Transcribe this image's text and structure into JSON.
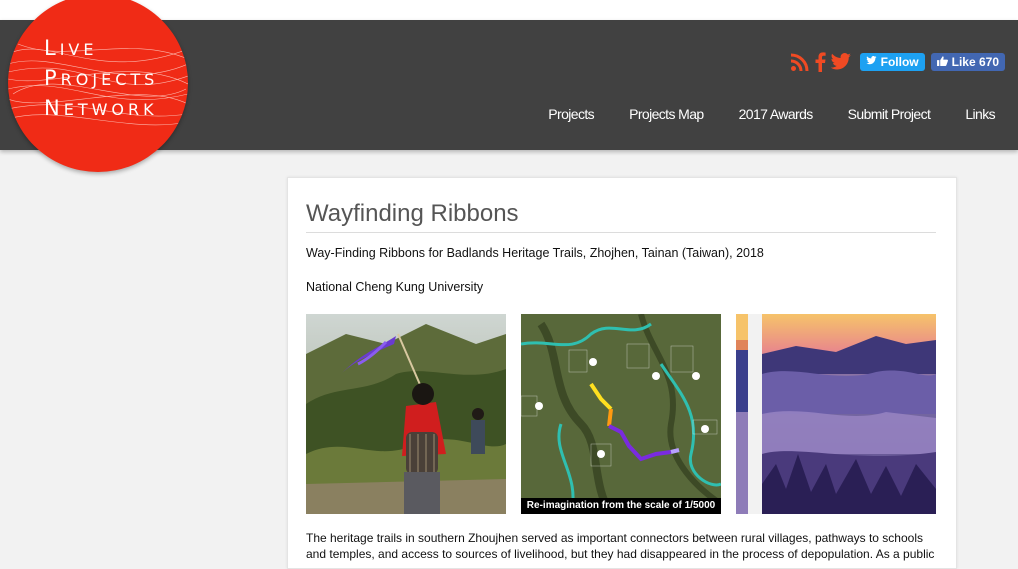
{
  "logo": {
    "line1": "Live",
    "line2": "Projects",
    "line3": "Network"
  },
  "social": {
    "rss_icon": "rss-icon",
    "facebook_icon": "facebook-icon",
    "twitter_icon": "twitter-bird-icon",
    "follow_label": "Follow",
    "like_label": "Like 670"
  },
  "nav": {
    "items": [
      "Projects",
      "Projects Map",
      "2017 Awards",
      "Submit Project",
      "Links"
    ]
  },
  "article": {
    "title": "Wayfinding Ribbons",
    "subtitle": "Way-Finding Ribbons for Badlands Heritage Trails, Zhojhen, Tainan (Taiwan), 2018",
    "university": "National Cheng Kung University",
    "map_caption": "Re-imagination from the scale of 1/5000",
    "body": "The heritage trails in southern Zhoujhen served as important connectors between rural villages, pathways to schools and temples, and access to sources of livelihood, but they had disappeared in the process of depopulation. As a public"
  },
  "colors": {
    "header_bg": "#414141",
    "logo_red": "#f02b16",
    "accent": "#f04a23",
    "twitter_blue": "#1da1f2",
    "facebook_blue": "#4267b2"
  }
}
